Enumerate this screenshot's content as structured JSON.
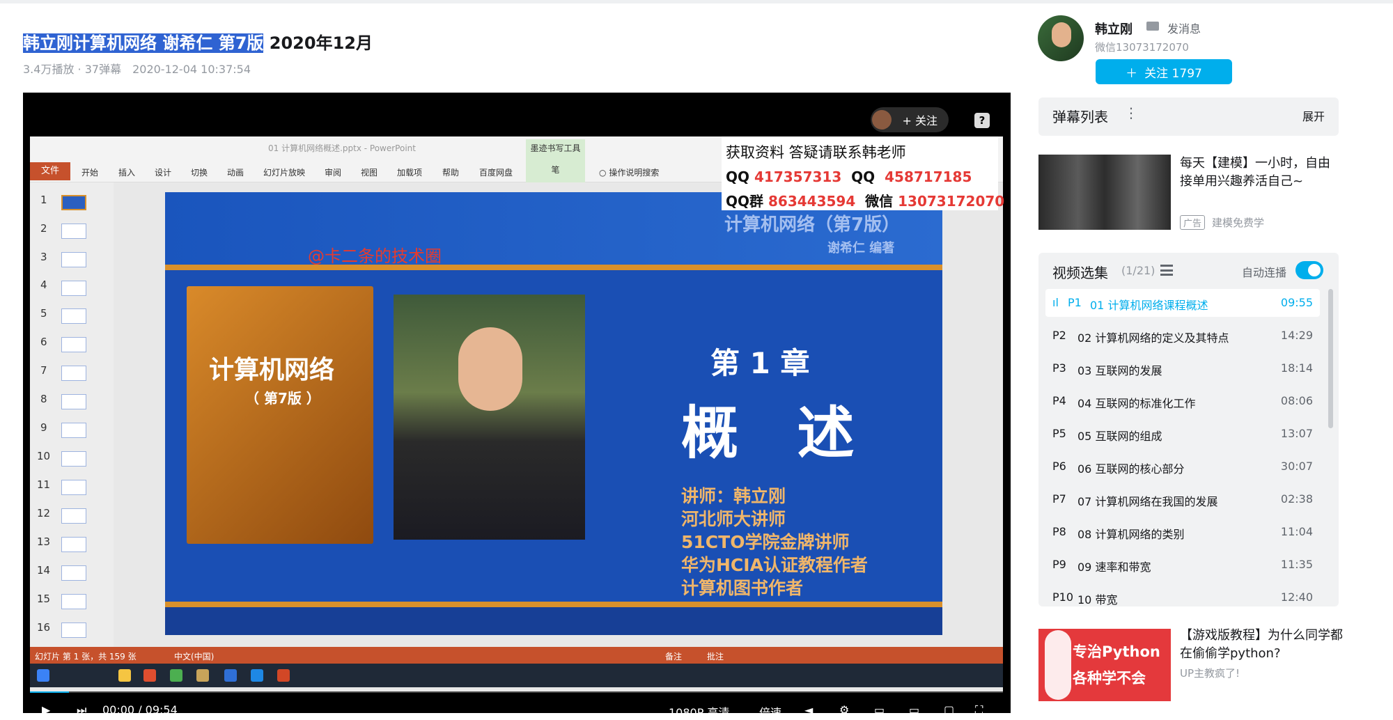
{
  "video": {
    "title_highlight": "韩立刚计算机网络 谢希仁 第7版",
    "title_rest": " 2020年12月",
    "plays": "3.4万播放 · 37弹幕",
    "date": "2020-12-04 10:37:54"
  },
  "player": {
    "follow_label": "+ 关注",
    "help_label": "?",
    "ppt": {
      "window_title": "01 计算机网络概述.pptx - PowerPoint",
      "pen_tool": "墨迹书写工具",
      "pen_sub": "笔",
      "tabs": [
        "文件",
        "开始",
        "插入",
        "设计",
        "切换",
        "动画",
        "幻灯片放映",
        "审阅",
        "视图",
        "加载项",
        "帮助",
        "百度网盘"
      ],
      "search": "操作说明搜索",
      "thumb_numbers": [
        "1",
        "2",
        "3",
        "4",
        "5",
        "6",
        "7",
        "8",
        "9",
        "10",
        "11",
        "12",
        "13",
        "14",
        "15",
        "16"
      ],
      "status_left": "幻灯片 第 1 张，共 159 张",
      "status_lang": "中文(中国)",
      "status_notes": "备注",
      "status_comments": "批注"
    },
    "slide": {
      "book_header": "计算机网络（第7版）",
      "author_header": "谢希仁  编著",
      "book_title": "计算机网络",
      "book_edition": "（ 第7版 ）",
      "chapter": "第 1 章",
      "chapter_title": "概 述",
      "lecturer_lines": [
        "讲师：韩立刚",
        "河北师大讲师",
        "51CTO学院金牌讲师",
        "华为HCIA认证教程作者",
        "计算机图书作者"
      ],
      "watermark": "@卡二条的技术圈"
    },
    "contact": {
      "line1": "获取资料 答疑请联系韩老师",
      "qq_label": "QQ",
      "qq1": "417357313",
      "qq2_label": "QQ",
      "qq2": "458717185",
      "group_label": "QQ群",
      "group": "863443594",
      "wechat_label": "微信",
      "wechat": "13073172070"
    },
    "controls": {
      "time": "00:00 / 09:54",
      "quality": "1080P 高清",
      "speed": "倍速"
    }
  },
  "uploader": {
    "name": "韩立刚",
    "message": "发消息",
    "wechat": "微信13073172070",
    "follow": "关注 1797"
  },
  "danmaku": {
    "title": "弹幕列表",
    "expand": "展开"
  },
  "ad1": {
    "title": "每天【建模】一小时，自由接单用兴趣养活自己~",
    "tag": "广告",
    "source": "建模免费学"
  },
  "playlist": {
    "title": "视频选集",
    "count": "(1/21)",
    "autoplay": "自动连播",
    "episodes": [
      {
        "num": "P1",
        "name": "01 计算机网络课程概述",
        "dur": "09:55"
      },
      {
        "num": "P2",
        "name": "02 计算机网络的定义及其特点",
        "dur": "14:29"
      },
      {
        "num": "P3",
        "name": "03 互联网的发展",
        "dur": "18:14"
      },
      {
        "num": "P4",
        "name": "04 互联网的标准化工作",
        "dur": "08:06"
      },
      {
        "num": "P5",
        "name": "05 互联网的组成",
        "dur": "13:07"
      },
      {
        "num": "P6",
        "name": "06 互联网的核心部分",
        "dur": "30:07"
      },
      {
        "num": "P7",
        "name": "07 计算机网络在我国的发展",
        "dur": "02:38"
      },
      {
        "num": "P8",
        "name": "08 计算机网络的类别",
        "dur": "11:04"
      },
      {
        "num": "P9",
        "name": "09 速率和带宽",
        "dur": "11:35"
      },
      {
        "num": "P10",
        "name": "10 带宽",
        "dur": "12:40"
      }
    ]
  },
  "ad2": {
    "img_line1": "专治Python",
    "img_line2": "各种学不会",
    "title": "【游戏版教程】为什么同学都在偷偷学python?",
    "source": "UP主教疯了!"
  },
  "colors": {
    "accent": "#00aeec",
    "ppt": "#c6512c",
    "slide": "#1a4fb4"
  }
}
